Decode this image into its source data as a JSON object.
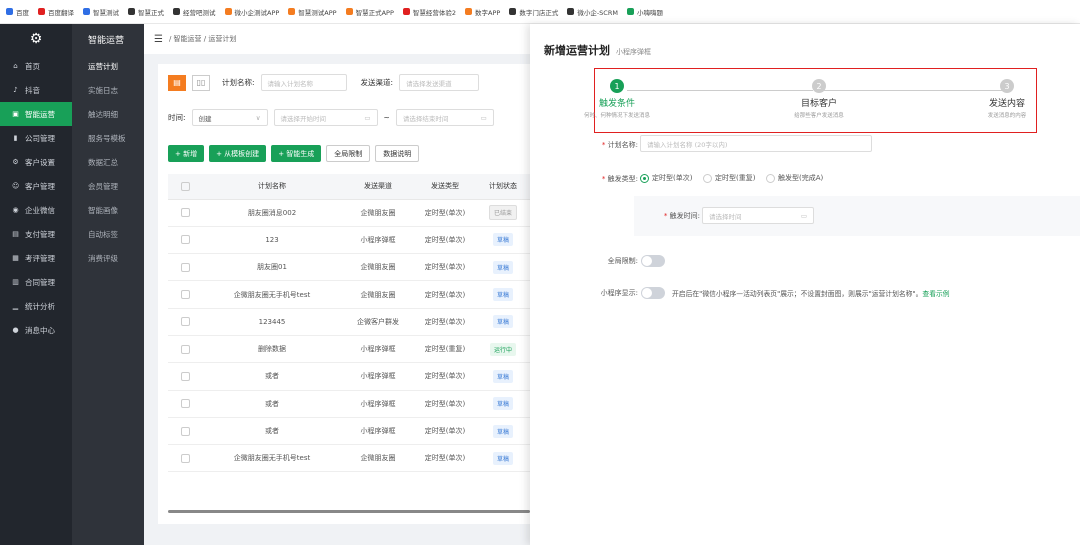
{
  "bookmarks": [
    {
      "label": "百度",
      "color": "#2f6ee5"
    },
    {
      "label": "百度翻译",
      "color": "#e02020"
    },
    {
      "label": "智慧测试",
      "color": "#2f6ee5"
    },
    {
      "label": "智慧正式",
      "color": "#333333"
    },
    {
      "label": "经营吧测试",
      "color": "#333333"
    },
    {
      "label": "微小企测试APP",
      "color": "#f47c20"
    },
    {
      "label": "智慧测试APP",
      "color": "#f47c20"
    },
    {
      "label": "智慧正式APP",
      "color": "#f47c20"
    },
    {
      "label": "智慧经营体验2",
      "color": "#e02020"
    },
    {
      "label": "数字APP",
      "color": "#f47c20"
    },
    {
      "label": "数字门店正式",
      "color": "#333333"
    },
    {
      "label": "微小企-SCRM",
      "color": "#333333"
    },
    {
      "label": "小嗨嗨题",
      "color": "#18a058"
    }
  ],
  "sidebar": {
    "app_title": "智能运营",
    "menu": [
      {
        "icon": "⌂",
        "label": "首页"
      },
      {
        "icon": "♪",
        "label": "抖音"
      },
      {
        "icon": "▣",
        "label": "智能运营"
      },
      {
        "icon": "▮",
        "label": "公司管理"
      },
      {
        "icon": "⚙",
        "label": "客户设置"
      },
      {
        "icon": "☺",
        "label": "客户管理"
      },
      {
        "icon": "◉",
        "label": "企业微信"
      },
      {
        "icon": "▤",
        "label": "支付管理"
      },
      {
        "icon": "▦",
        "label": "考评管理"
      },
      {
        "icon": "▥",
        "label": "合同管理"
      },
      {
        "icon": "▁",
        "label": "统计分析"
      },
      {
        "icon": "●",
        "label": "消息中心"
      }
    ],
    "submenu": [
      "运营计划",
      "实施日志",
      "触达明细",
      "服务号模板",
      "数据汇总",
      "会员管理",
      "智能画像",
      "自动标签",
      "消费评级"
    ]
  },
  "breadcrumb": "/ 智能运营 / 运营计划",
  "filters": {
    "plan_name_label": "计划名称:",
    "plan_name_placeholder": "请输入计划名称",
    "channel_label": "发送渠道:",
    "channel_placeholder": "请选择发送渠道",
    "time_label": "时间:",
    "time_type": "创建",
    "start_placeholder": "请选择开始时间",
    "range_sep": "~",
    "end_placeholder": "请选择结束时间"
  },
  "actions": {
    "add": "+ 新增",
    "from_template": "+ 从模板创建",
    "smart": "+ 智能生成",
    "global_limit": "全局限制",
    "data_desc": "数据说明"
  },
  "table": {
    "headers": [
      "计划名称",
      "发送渠道",
      "发送类型",
      "计划状态"
    ],
    "rows": [
      {
        "name": "朋友圈消息002",
        "channel": "企微朋友圈",
        "type": "定时型(单次)",
        "status": "已结束",
        "kind": "done"
      },
      {
        "name": "123",
        "channel": "小程序弹框",
        "type": "定时型(单次)",
        "status": "草稿",
        "kind": "draft"
      },
      {
        "name": "朋友圈01",
        "channel": "企微朋友圈",
        "type": "定时型(单次)",
        "status": "草稿",
        "kind": "draft"
      },
      {
        "name": "企微朋友圈无手机号test",
        "channel": "企微朋友圈",
        "type": "定时型(单次)",
        "status": "草稿",
        "kind": "draft"
      },
      {
        "name": "123445",
        "channel": "企微客户群发",
        "type": "定时型(单次)",
        "status": "草稿",
        "kind": "draft"
      },
      {
        "name": "删除数据",
        "channel": "小程序弹框",
        "type": "定时型(重复)",
        "status": "运行中",
        "kind": "run"
      },
      {
        "name": "或者",
        "channel": "小程序弹框",
        "type": "定时型(单次)",
        "status": "草稿",
        "kind": "draft"
      },
      {
        "name": "或者",
        "channel": "小程序弹框",
        "type": "定时型(单次)",
        "status": "草稿",
        "kind": "draft"
      },
      {
        "name": "或者",
        "channel": "小程序弹框",
        "type": "定时型(单次)",
        "status": "草稿",
        "kind": "draft"
      },
      {
        "name": "企微朋友圈无手机号test",
        "channel": "企微朋友圈",
        "type": "定时型(单次)",
        "status": "草稿",
        "kind": "draft"
      }
    ]
  },
  "panel": {
    "title": "新增运营计划",
    "subtitle": "小程序弹框",
    "steps": [
      {
        "num": "1",
        "title": "触发条件",
        "desc": "何时、何种情况下发送消息"
      },
      {
        "num": "2",
        "title": "目标客户",
        "desc": "给那些客户发送消息"
      },
      {
        "num": "3",
        "title": "发送内容",
        "desc": "发送消息的内容"
      }
    ],
    "plan_name_label": "计划名称:",
    "plan_name_placeholder": "请输入计划名称 (20字以内)",
    "trigger_type_label": "触发类型:",
    "trigger_options": [
      "定时型(单次)",
      "定时型(重复)",
      "触发型(完成A)"
    ],
    "trigger_time_label": "触发时间:",
    "trigger_time_placeholder": "请选择时间",
    "global_limit_label": "全局限制:",
    "mini_display_label": "小程序显示:",
    "mini_display_desc": "开启后在\"微信小程序—活动列表页\"展示；不设置封面图，则展示\"运营计划名称\"。",
    "view_example": "查看示例"
  },
  "colors": {
    "accent": "#18a058",
    "orange": "#f47c20",
    "red": "#e02020"
  }
}
